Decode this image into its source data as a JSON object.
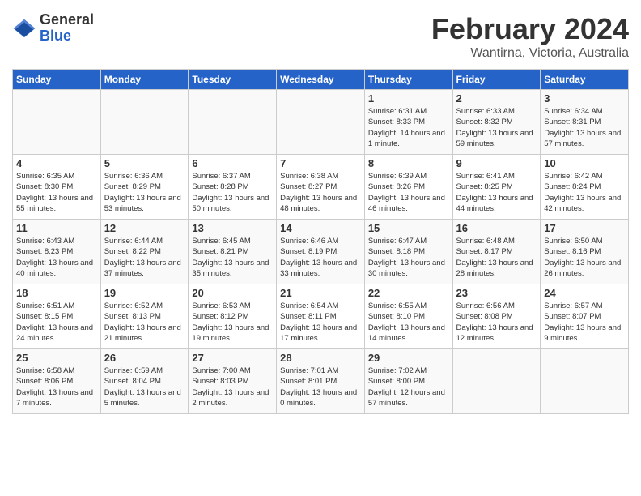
{
  "header": {
    "logo_general": "General",
    "logo_blue": "Blue",
    "month": "February 2024",
    "location": "Wantirna, Victoria, Australia"
  },
  "days_of_week": [
    "Sunday",
    "Monday",
    "Tuesday",
    "Wednesday",
    "Thursday",
    "Friday",
    "Saturday"
  ],
  "weeks": [
    [
      {
        "day": "",
        "info": ""
      },
      {
        "day": "",
        "info": ""
      },
      {
        "day": "",
        "info": ""
      },
      {
        "day": "",
        "info": ""
      },
      {
        "day": "1",
        "info": "Sunrise: 6:31 AM\nSunset: 8:33 PM\nDaylight: 14 hours and 1 minute."
      },
      {
        "day": "2",
        "info": "Sunrise: 6:33 AM\nSunset: 8:32 PM\nDaylight: 13 hours and 59 minutes."
      },
      {
        "day": "3",
        "info": "Sunrise: 6:34 AM\nSunset: 8:31 PM\nDaylight: 13 hours and 57 minutes."
      }
    ],
    [
      {
        "day": "4",
        "info": "Sunrise: 6:35 AM\nSunset: 8:30 PM\nDaylight: 13 hours and 55 minutes."
      },
      {
        "day": "5",
        "info": "Sunrise: 6:36 AM\nSunset: 8:29 PM\nDaylight: 13 hours and 53 minutes."
      },
      {
        "day": "6",
        "info": "Sunrise: 6:37 AM\nSunset: 8:28 PM\nDaylight: 13 hours and 50 minutes."
      },
      {
        "day": "7",
        "info": "Sunrise: 6:38 AM\nSunset: 8:27 PM\nDaylight: 13 hours and 48 minutes."
      },
      {
        "day": "8",
        "info": "Sunrise: 6:39 AM\nSunset: 8:26 PM\nDaylight: 13 hours and 46 minutes."
      },
      {
        "day": "9",
        "info": "Sunrise: 6:41 AM\nSunset: 8:25 PM\nDaylight: 13 hours and 44 minutes."
      },
      {
        "day": "10",
        "info": "Sunrise: 6:42 AM\nSunset: 8:24 PM\nDaylight: 13 hours and 42 minutes."
      }
    ],
    [
      {
        "day": "11",
        "info": "Sunrise: 6:43 AM\nSunset: 8:23 PM\nDaylight: 13 hours and 40 minutes."
      },
      {
        "day": "12",
        "info": "Sunrise: 6:44 AM\nSunset: 8:22 PM\nDaylight: 13 hours and 37 minutes."
      },
      {
        "day": "13",
        "info": "Sunrise: 6:45 AM\nSunset: 8:21 PM\nDaylight: 13 hours and 35 minutes."
      },
      {
        "day": "14",
        "info": "Sunrise: 6:46 AM\nSunset: 8:19 PM\nDaylight: 13 hours and 33 minutes."
      },
      {
        "day": "15",
        "info": "Sunrise: 6:47 AM\nSunset: 8:18 PM\nDaylight: 13 hours and 30 minutes."
      },
      {
        "day": "16",
        "info": "Sunrise: 6:48 AM\nSunset: 8:17 PM\nDaylight: 13 hours and 28 minutes."
      },
      {
        "day": "17",
        "info": "Sunrise: 6:50 AM\nSunset: 8:16 PM\nDaylight: 13 hours and 26 minutes."
      }
    ],
    [
      {
        "day": "18",
        "info": "Sunrise: 6:51 AM\nSunset: 8:15 PM\nDaylight: 13 hours and 24 minutes."
      },
      {
        "day": "19",
        "info": "Sunrise: 6:52 AM\nSunset: 8:13 PM\nDaylight: 13 hours and 21 minutes."
      },
      {
        "day": "20",
        "info": "Sunrise: 6:53 AM\nSunset: 8:12 PM\nDaylight: 13 hours and 19 minutes."
      },
      {
        "day": "21",
        "info": "Sunrise: 6:54 AM\nSunset: 8:11 PM\nDaylight: 13 hours and 17 minutes."
      },
      {
        "day": "22",
        "info": "Sunrise: 6:55 AM\nSunset: 8:10 PM\nDaylight: 13 hours and 14 minutes."
      },
      {
        "day": "23",
        "info": "Sunrise: 6:56 AM\nSunset: 8:08 PM\nDaylight: 13 hours and 12 minutes."
      },
      {
        "day": "24",
        "info": "Sunrise: 6:57 AM\nSunset: 8:07 PM\nDaylight: 13 hours and 9 minutes."
      }
    ],
    [
      {
        "day": "25",
        "info": "Sunrise: 6:58 AM\nSunset: 8:06 PM\nDaylight: 13 hours and 7 minutes."
      },
      {
        "day": "26",
        "info": "Sunrise: 6:59 AM\nSunset: 8:04 PM\nDaylight: 13 hours and 5 minutes."
      },
      {
        "day": "27",
        "info": "Sunrise: 7:00 AM\nSunset: 8:03 PM\nDaylight: 13 hours and 2 minutes."
      },
      {
        "day": "28",
        "info": "Sunrise: 7:01 AM\nSunset: 8:01 PM\nDaylight: 13 hours and 0 minutes."
      },
      {
        "day": "29",
        "info": "Sunrise: 7:02 AM\nSunset: 8:00 PM\nDaylight: 12 hours and 57 minutes."
      },
      {
        "day": "",
        "info": ""
      },
      {
        "day": "",
        "info": ""
      }
    ]
  ]
}
